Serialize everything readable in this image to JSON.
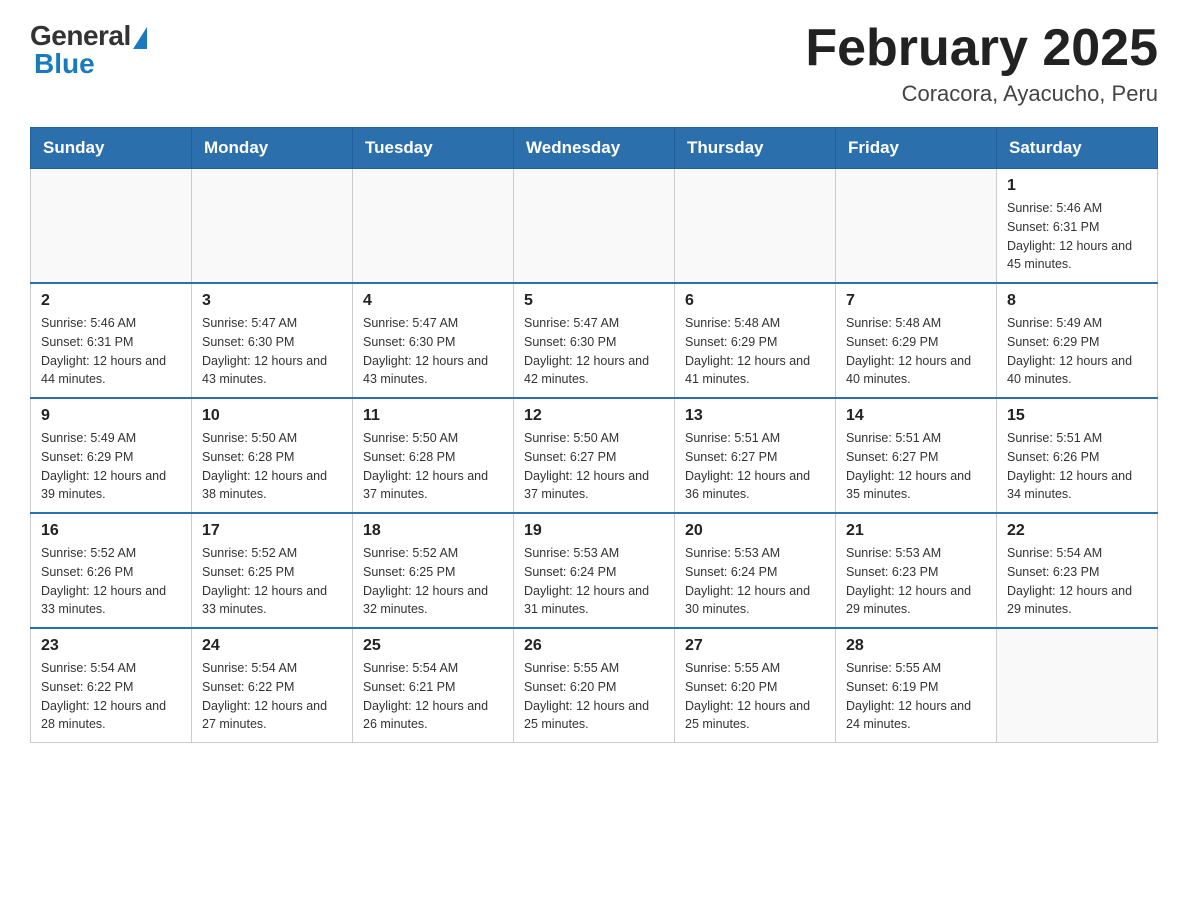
{
  "header": {
    "logo_general": "General",
    "logo_blue": "Blue",
    "title": "February 2025",
    "location": "Coracora, Ayacucho, Peru"
  },
  "days_of_week": [
    "Sunday",
    "Monday",
    "Tuesday",
    "Wednesday",
    "Thursday",
    "Friday",
    "Saturday"
  ],
  "weeks": [
    [
      {
        "day": "",
        "info": ""
      },
      {
        "day": "",
        "info": ""
      },
      {
        "day": "",
        "info": ""
      },
      {
        "day": "",
        "info": ""
      },
      {
        "day": "",
        "info": ""
      },
      {
        "day": "",
        "info": ""
      },
      {
        "day": "1",
        "info": "Sunrise: 5:46 AM\nSunset: 6:31 PM\nDaylight: 12 hours and 45 minutes."
      }
    ],
    [
      {
        "day": "2",
        "info": "Sunrise: 5:46 AM\nSunset: 6:31 PM\nDaylight: 12 hours and 44 minutes."
      },
      {
        "day": "3",
        "info": "Sunrise: 5:47 AM\nSunset: 6:30 PM\nDaylight: 12 hours and 43 minutes."
      },
      {
        "day": "4",
        "info": "Sunrise: 5:47 AM\nSunset: 6:30 PM\nDaylight: 12 hours and 43 minutes."
      },
      {
        "day": "5",
        "info": "Sunrise: 5:47 AM\nSunset: 6:30 PM\nDaylight: 12 hours and 42 minutes."
      },
      {
        "day": "6",
        "info": "Sunrise: 5:48 AM\nSunset: 6:29 PM\nDaylight: 12 hours and 41 minutes."
      },
      {
        "day": "7",
        "info": "Sunrise: 5:48 AM\nSunset: 6:29 PM\nDaylight: 12 hours and 40 minutes."
      },
      {
        "day": "8",
        "info": "Sunrise: 5:49 AM\nSunset: 6:29 PM\nDaylight: 12 hours and 40 minutes."
      }
    ],
    [
      {
        "day": "9",
        "info": "Sunrise: 5:49 AM\nSunset: 6:29 PM\nDaylight: 12 hours and 39 minutes."
      },
      {
        "day": "10",
        "info": "Sunrise: 5:50 AM\nSunset: 6:28 PM\nDaylight: 12 hours and 38 minutes."
      },
      {
        "day": "11",
        "info": "Sunrise: 5:50 AM\nSunset: 6:28 PM\nDaylight: 12 hours and 37 minutes."
      },
      {
        "day": "12",
        "info": "Sunrise: 5:50 AM\nSunset: 6:27 PM\nDaylight: 12 hours and 37 minutes."
      },
      {
        "day": "13",
        "info": "Sunrise: 5:51 AM\nSunset: 6:27 PM\nDaylight: 12 hours and 36 minutes."
      },
      {
        "day": "14",
        "info": "Sunrise: 5:51 AM\nSunset: 6:27 PM\nDaylight: 12 hours and 35 minutes."
      },
      {
        "day": "15",
        "info": "Sunrise: 5:51 AM\nSunset: 6:26 PM\nDaylight: 12 hours and 34 minutes."
      }
    ],
    [
      {
        "day": "16",
        "info": "Sunrise: 5:52 AM\nSunset: 6:26 PM\nDaylight: 12 hours and 33 minutes."
      },
      {
        "day": "17",
        "info": "Sunrise: 5:52 AM\nSunset: 6:25 PM\nDaylight: 12 hours and 33 minutes."
      },
      {
        "day": "18",
        "info": "Sunrise: 5:52 AM\nSunset: 6:25 PM\nDaylight: 12 hours and 32 minutes."
      },
      {
        "day": "19",
        "info": "Sunrise: 5:53 AM\nSunset: 6:24 PM\nDaylight: 12 hours and 31 minutes."
      },
      {
        "day": "20",
        "info": "Sunrise: 5:53 AM\nSunset: 6:24 PM\nDaylight: 12 hours and 30 minutes."
      },
      {
        "day": "21",
        "info": "Sunrise: 5:53 AM\nSunset: 6:23 PM\nDaylight: 12 hours and 29 minutes."
      },
      {
        "day": "22",
        "info": "Sunrise: 5:54 AM\nSunset: 6:23 PM\nDaylight: 12 hours and 29 minutes."
      }
    ],
    [
      {
        "day": "23",
        "info": "Sunrise: 5:54 AM\nSunset: 6:22 PM\nDaylight: 12 hours and 28 minutes."
      },
      {
        "day": "24",
        "info": "Sunrise: 5:54 AM\nSunset: 6:22 PM\nDaylight: 12 hours and 27 minutes."
      },
      {
        "day": "25",
        "info": "Sunrise: 5:54 AM\nSunset: 6:21 PM\nDaylight: 12 hours and 26 minutes."
      },
      {
        "day": "26",
        "info": "Sunrise: 5:55 AM\nSunset: 6:20 PM\nDaylight: 12 hours and 25 minutes."
      },
      {
        "day": "27",
        "info": "Sunrise: 5:55 AM\nSunset: 6:20 PM\nDaylight: 12 hours and 25 minutes."
      },
      {
        "day": "28",
        "info": "Sunrise: 5:55 AM\nSunset: 6:19 PM\nDaylight: 12 hours and 24 minutes."
      },
      {
        "day": "",
        "info": ""
      }
    ]
  ]
}
